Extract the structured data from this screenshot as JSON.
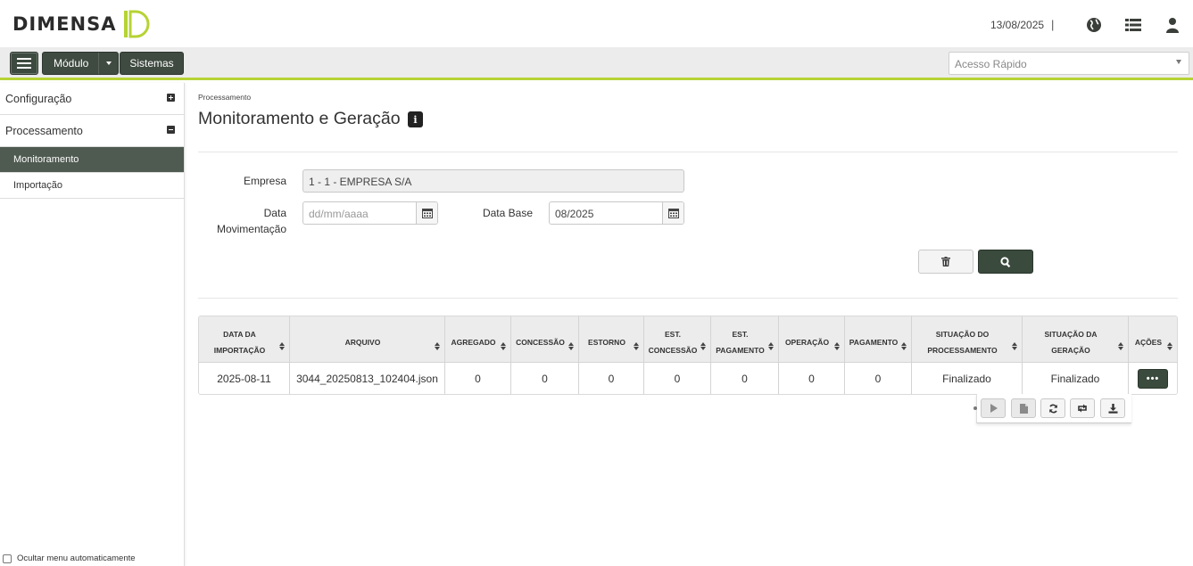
{
  "header": {
    "logo_text": "DIMENSA",
    "date": "13/08/2025",
    "separator": "|",
    "icons": [
      "globe-icon",
      "list-icon",
      "user-icon"
    ]
  },
  "toolbar": {
    "modulo_label": "Módulo",
    "sistemas_label": "Sistemas",
    "quick_access_placeholder": "Acesso Rápido"
  },
  "sidebar": {
    "groups": [
      {
        "label": "Configuração",
        "state": "collapsed"
      },
      {
        "label": "Processamento",
        "state": "expanded"
      }
    ],
    "items": [
      {
        "label": "Monitoramento",
        "active": true
      },
      {
        "label": "Importação",
        "active": false
      }
    ],
    "auto_hide_label": "Ocultar menu automaticamente"
  },
  "page": {
    "breadcrumb": "Processamento",
    "title": "Monitoramento e Geração"
  },
  "form": {
    "empresa_label": "Empresa",
    "empresa_value": "1 - 1 - EMPRESA S/A",
    "data_mov_label_1": "Data",
    "data_mov_label_2": "Movimentação",
    "data_mov_placeholder": "dd/mm/aaaa",
    "data_base_label": "Data Base",
    "data_base_value": "08/2025"
  },
  "table": {
    "headers": [
      [
        "DATA DA",
        "IMPORTAÇÃO"
      ],
      [
        "",
        "ARQUIVO"
      ],
      [
        "",
        "AGREGADO"
      ],
      [
        "",
        "CONCESSÃO"
      ],
      [
        "",
        "ESTORNO"
      ],
      [
        "EST.",
        "CONCESSÃO"
      ],
      [
        "EST.",
        "PAGAMENTO"
      ],
      [
        "",
        "OPERAÇÃO"
      ],
      [
        "",
        "PAGAMENTO"
      ],
      [
        "SITUAÇÃO DO",
        "PROCESSAMENTO"
      ],
      [
        "",
        "SITUAÇÃO DA GERAÇÃO"
      ],
      [
        "",
        "AÇÕES"
      ]
    ],
    "rows": [
      [
        "2025-08-11",
        "3044_20250813_102404.json",
        "0",
        "0",
        "0",
        "0",
        "0",
        "0",
        "0",
        "Finalizado",
        "Finalizado"
      ]
    ],
    "more_label": "•••"
  },
  "actions": [
    "play-icon",
    "file-icon",
    "refresh-icon",
    "retweet-icon",
    "download-icon"
  ],
  "colors": {
    "accent": "#b6d334",
    "dark": "#3a4a3d",
    "sidebar_active": "#4f5a51"
  }
}
